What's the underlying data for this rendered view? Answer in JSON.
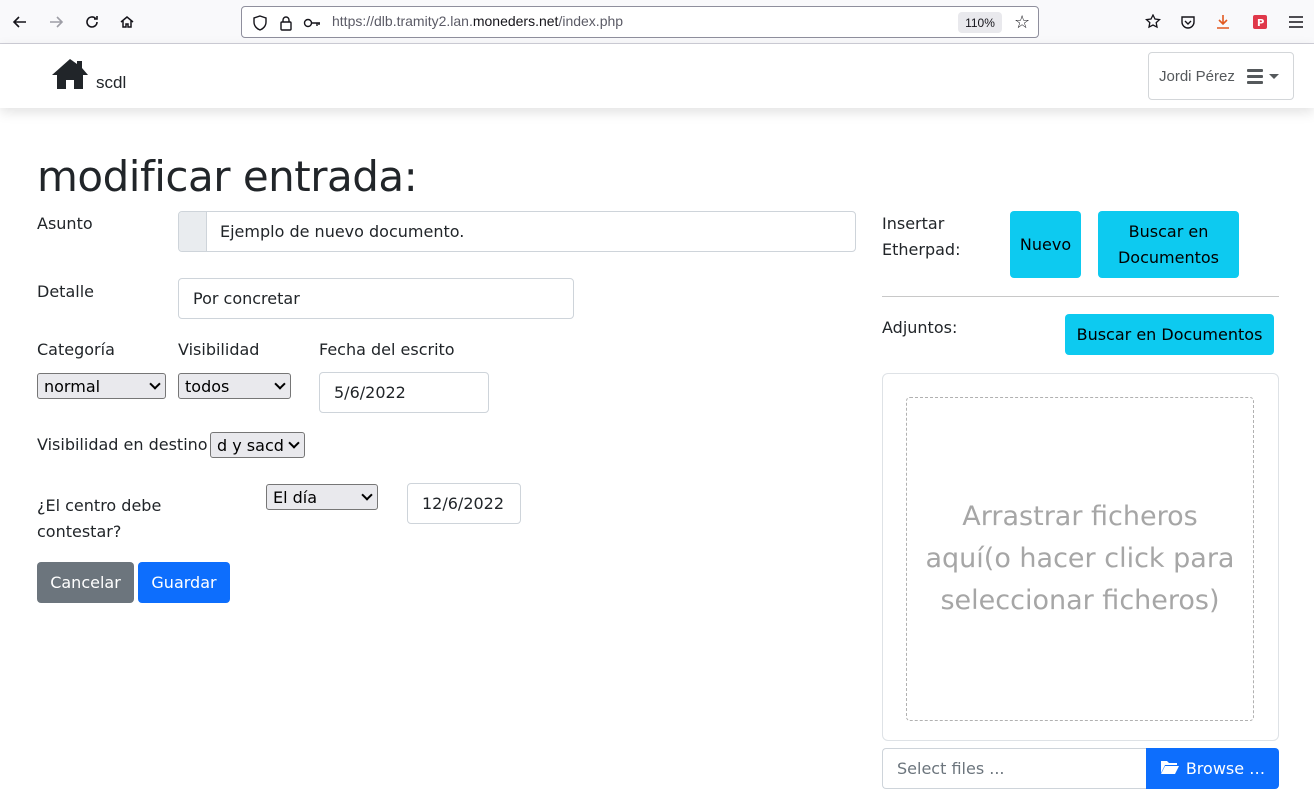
{
  "browser": {
    "url_prefix": "https://dlb.tramity2.lan.",
    "url_domain": "moneders.net",
    "url_suffix": "/index.php",
    "zoom": "110%"
  },
  "navbar": {
    "brand": "scdl",
    "user": "Jordi Pérez"
  },
  "page": {
    "title": "modificar entrada:"
  },
  "form": {
    "asunto_label": "Asunto",
    "asunto_value": "Ejemplo de nuevo documento.",
    "detalle_label": "Detalle",
    "detalle_value": "Por concretar",
    "categoria_label": "Categoría",
    "categoria_value": "normal",
    "visibilidad_label": "Visibilidad",
    "visibilidad_value": "todos",
    "fecha_label": "Fecha del escrito",
    "fecha_value": "5/6/2022",
    "vis_destino_label": "Visibilidad en destino",
    "vis_destino_value": "d y sacd",
    "contestar_label_1": "¿El centro debe",
    "contestar_label_2": "contestar?",
    "contestar_value": "El día",
    "contestar_fecha": "12/6/2022",
    "cancel_label": "Cancelar",
    "save_label": "Guardar"
  },
  "sidebar": {
    "etherpad_label_1": "Insertar",
    "etherpad_label_2": "Etherpad:",
    "nuevo_label": "Nuevo",
    "buscar_doc_label_1": "Buscar en",
    "buscar_doc_label_2": "Documentos",
    "adjuntos_label": "Adjuntos:",
    "buscar_adj_label": "Buscar en Documentos",
    "dropzone_text": "Arrastrar ficheros aquí(o hacer click para seleccionar ficheros)",
    "file_placeholder": "Select files ...",
    "browse_label": "Browse …"
  },
  "colors": {
    "primary": "#0d6efd",
    "info": "#0dcaf0",
    "secondary": "#6c757d"
  }
}
